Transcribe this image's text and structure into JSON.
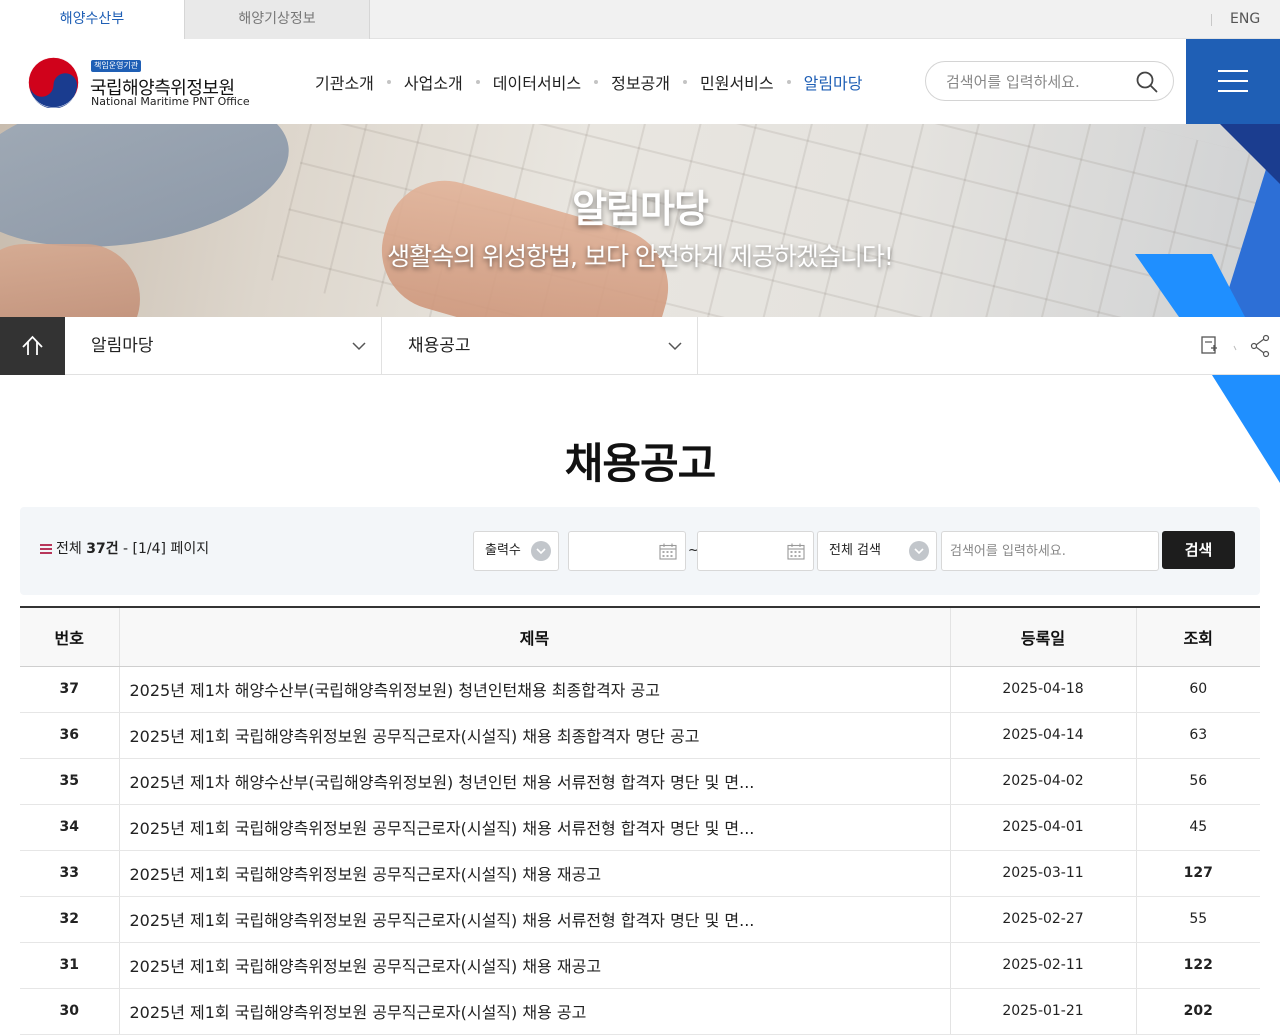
{
  "topbar": {
    "tabs": [
      {
        "label": "해양수산부"
      },
      {
        "label": "해양기상정보"
      }
    ],
    "lang": "ENG"
  },
  "header": {
    "logo_tag": "책임운영기관",
    "logo_kor": "국립해양측위정보원",
    "logo_eng": "National Maritime PNT Office",
    "nav": [
      {
        "label": "기관소개"
      },
      {
        "label": "사업소개"
      },
      {
        "label": "데이터서비스"
      },
      {
        "label": "정보공개"
      },
      {
        "label": "민원서비스"
      },
      {
        "label": "알림마당"
      }
    ],
    "search_placeholder": "검색어를 입력하세요.",
    "accent_color": "#1f5fb5"
  },
  "hero": {
    "title": "알림마당",
    "subtitle": "생활속의 위성항법, 보다 안전하게 제공하겠습니다!"
  },
  "location": {
    "level1": "알림마당",
    "level2": "채용공고"
  },
  "page": {
    "title": "채용공고"
  },
  "search": {
    "total_prefix": "전체",
    "total_count": "37건",
    "page_info": "- [1/4] 페이지",
    "page_size_label": "출력수",
    "date_from": "",
    "date_to": "",
    "range_sep": "~",
    "field_label": "전체 검색",
    "keyword_placeholder": "검색어를 입력하세요.",
    "button_label": "검색"
  },
  "table": {
    "headers": [
      "번호",
      "제목",
      "등록일",
      "조회"
    ],
    "rows": [
      {
        "no": "37",
        "title": "2025년 제1차 해양수산부(국립해양측위정보원) 청년인턴채용 최종합격자 공고",
        "date": "2025-04-18",
        "hits": "60"
      },
      {
        "no": "36",
        "title": "2025년 제1회 국립해양측위정보원 공무직근로자(시설직) 채용 최종합격자 명단 공고",
        "date": "2025-04-14",
        "hits": "63"
      },
      {
        "no": "35",
        "title": "2025년 제1차 해양수산부(국립해양측위정보원) 청년인턴 채용 서류전형 합격자 명단 및 면...",
        "date": "2025-04-02",
        "hits": "56"
      },
      {
        "no": "34",
        "title": "2025년 제1회 국립해양측위정보원 공무직근로자(시설직) 채용 서류전형 합격자 명단 및 면...",
        "date": "2025-04-01",
        "hits": "45"
      },
      {
        "no": "33",
        "title": "2025년 제1회 국립해양측위정보원 공무직근로자(시설직) 채용 재공고",
        "date": "2025-03-11",
        "hits": "127"
      },
      {
        "no": "32",
        "title": "2025년 제1회 국립해양측위정보원 공무직근로자(시설직) 채용 서류전형 합격자 명단 및 면...",
        "date": "2025-02-27",
        "hits": "55"
      },
      {
        "no": "31",
        "title": "2025년 제1회 국립해양측위정보원 공무직근로자(시설직) 채용 재공고",
        "date": "2025-02-11",
        "hits": "122"
      },
      {
        "no": "30",
        "title": "2025년 제1회 국립해양측위정보원 공무직근로자(시설직) 채용 공고",
        "date": "2025-01-21",
        "hits": "202"
      }
    ]
  }
}
